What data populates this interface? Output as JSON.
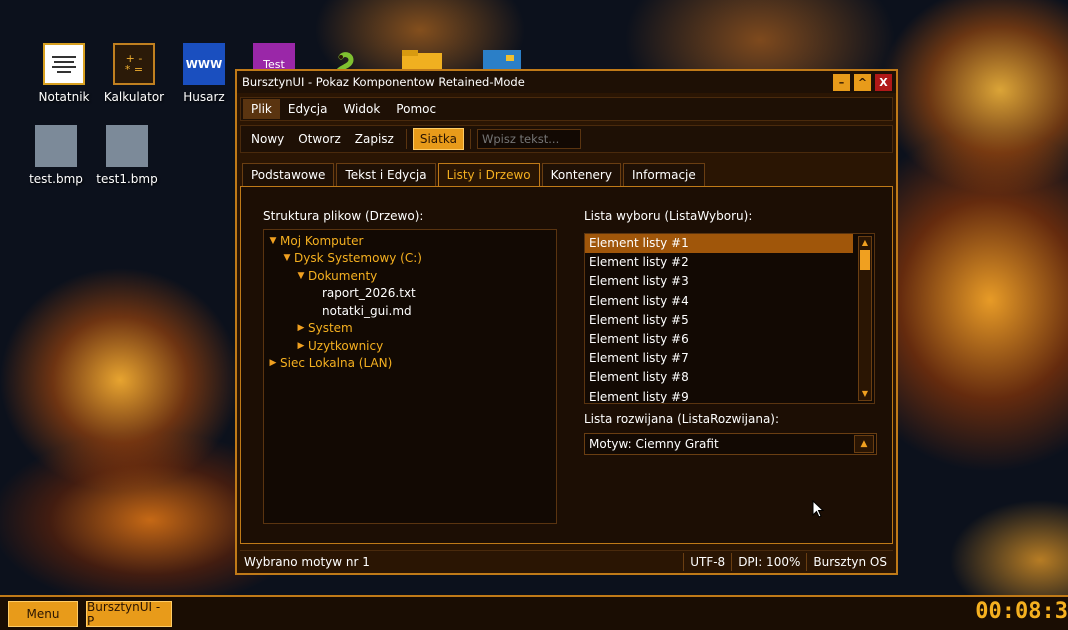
{
  "desktop": {
    "icons": [
      {
        "label": "Notatnik",
        "icon": "notepad-icon"
      },
      {
        "label": "Kalkulator",
        "icon": "calculator-icon",
        "glyph_top": "+ -",
        "glyph_bottom": "* ="
      },
      {
        "label": "Husarz",
        "icon": "browser-icon",
        "glyph": "WWW"
      },
      {
        "label": "",
        "icon": "test-app-icon",
        "glyph": "Test"
      },
      {
        "label": "",
        "icon": "python-icon"
      },
      {
        "label": "",
        "icon": "folder-icon"
      },
      {
        "label": "",
        "icon": "image-app-icon"
      },
      {
        "label": "test.bmp",
        "icon": "bitmap-file-icon"
      },
      {
        "label": "test1.bmp",
        "icon": "bitmap-file-icon"
      }
    ]
  },
  "window": {
    "title": "BursztynUI - Pokaz Komponentow Retained-Mode",
    "controls": {
      "minimize": "–",
      "maximize": "^",
      "close": "X"
    },
    "menu": [
      {
        "label": "Plik",
        "active": true
      },
      {
        "label": "Edycja"
      },
      {
        "label": "Widok"
      },
      {
        "label": "Pomoc"
      }
    ],
    "toolbar": {
      "new": "Nowy",
      "open": "Otworz",
      "save": "Zapisz",
      "grid_toggle": "Siatka",
      "input_placeholder": "Wpisz tekst..."
    },
    "tabs": [
      {
        "label": "Podstawowe"
      },
      {
        "label": "Tekst i Edycja"
      },
      {
        "label": "Listy i Drzewo",
        "active": true
      },
      {
        "label": "Kontenery"
      },
      {
        "label": "Informacje"
      }
    ],
    "tree_panel": {
      "label": "Struktura plikow (Drzewo):",
      "nodes": [
        {
          "text": "Moj Komputer",
          "depth": 0,
          "expanded": true,
          "type": "folder"
        },
        {
          "text": "Dysk Systemowy (C:)",
          "depth": 1,
          "expanded": true,
          "type": "folder"
        },
        {
          "text": "Dokumenty",
          "depth": 2,
          "expanded": true,
          "type": "folder"
        },
        {
          "text": "raport_2026.txt",
          "depth": 3,
          "type": "file"
        },
        {
          "text": "notatki_gui.md",
          "depth": 3,
          "type": "file"
        },
        {
          "text": "System",
          "depth": 2,
          "expanded": false,
          "type": "folder"
        },
        {
          "text": "Uzytkownicy",
          "depth": 2,
          "expanded": false,
          "type": "folder"
        },
        {
          "text": "Siec Lokalna (LAN)",
          "depth": 0,
          "expanded": false,
          "type": "folder"
        }
      ]
    },
    "list_panel": {
      "label": "Lista wyboru (ListaWyboru):",
      "items": [
        "Element listy #1",
        "Element listy #2",
        "Element listy #3",
        "Element listy #4",
        "Element listy #5",
        "Element listy #6",
        "Element listy #7",
        "Element listy #8",
        "Element listy #9"
      ],
      "selected_index": 0
    },
    "combo_panel": {
      "label": "Lista rozwijana (ListaRozwijana):",
      "value": "Motyw: Ciemny Grafit"
    },
    "statusbar": {
      "message": "Wybrano motyw nr 1",
      "encoding": "UTF-8",
      "dpi": "DPI: 100%",
      "os": "Bursztyn OS"
    }
  },
  "taskbar": {
    "menu": "Menu",
    "app": "BursztynUI - P",
    "clock": "00:08:3"
  },
  "colors": {
    "accent": "#e89b1a",
    "window_bg": "#2a1503",
    "border": "#c07a18",
    "tree_folder_text": "#f5b020",
    "selection": "#a0560a"
  }
}
